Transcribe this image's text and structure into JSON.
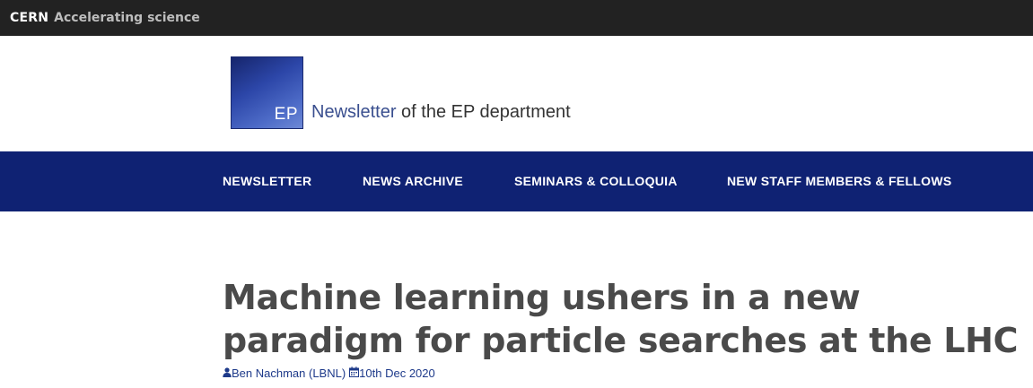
{
  "topbar": {
    "brand": "CERN",
    "tagline": "Accelerating science"
  },
  "header": {
    "logo_text": "EP",
    "title_accent": "Newsletter",
    "title_rest": " of the EP department"
  },
  "nav": {
    "items": [
      {
        "label": "NEWSLETTER"
      },
      {
        "label": "NEWS ARCHIVE"
      },
      {
        "label": "SEMINARS & COLLOQUIA"
      },
      {
        "label": "NEW STAFF MEMBERS & FELLOWS"
      }
    ]
  },
  "article": {
    "title": "Machine learning ushers in a new paradigm for particle searches at the LHC",
    "author": "Ben Nachman (LBNL)",
    "date": "10th Dec 2020"
  },
  "colors": {
    "topbar": "#222222",
    "nav": "#0f2273",
    "meta_link": "#1e3a8a"
  },
  "icons": {
    "author": "user-icon",
    "date": "calendar-icon"
  }
}
